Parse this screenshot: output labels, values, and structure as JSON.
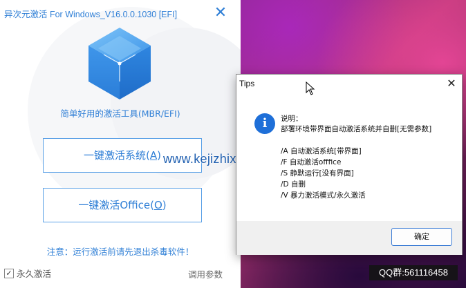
{
  "app": {
    "title": "异次元激活 For Windows_V16.0.0.1030 [EFI]",
    "close_glyph": "✕",
    "subtitle": "简单好用的激活工具(MBR/EFI)",
    "activate_button": {
      "prefix": "一键激活系统(",
      "hotkey": "A",
      "suffix": ")"
    },
    "office_button": {
      "prefix": "一键激活Office(",
      "hotkey": "O",
      "suffix": ")"
    },
    "notice": "注意：运行激活前请先退出杀毒软件！",
    "permanent_label": "永久激活",
    "permanent_checked": true,
    "params_label": "调用参数",
    "accent_color": "#2f7fd6"
  },
  "watermark": "www.kejizhixing.com",
  "dialog": {
    "title": "Tips",
    "close_glyph": "✕",
    "icon": "info-icon",
    "lines": [
      "说明：",
      "部署环境带界面自动激活系统并自删[无需参数]",
      "/A 自动激活系统[带界面]",
      "/F 自动激活offfice",
      "/S 静默运行[没有界面]",
      "/D 自删",
      "/V 暴力激活模式/永久激活"
    ],
    "ok_label": "确定"
  },
  "qq_badge": "QQ群:561116458"
}
